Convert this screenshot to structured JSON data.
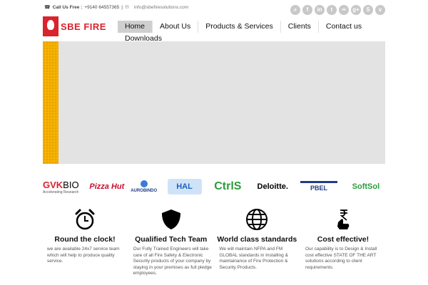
{
  "topbar": {
    "phone_label": "Call Us Free :",
    "phone_number": "+9140 64557365",
    "separator": "|",
    "email": "info@sbefiresolutions.com"
  },
  "social": [
    {
      "name": "search-icon",
      "glyph": "⌕"
    },
    {
      "name": "facebook-icon",
      "glyph": "f"
    },
    {
      "name": "linkedin-icon",
      "glyph": "in"
    },
    {
      "name": "twitter-icon",
      "glyph": "t"
    },
    {
      "name": "flickr-icon",
      "glyph": "••"
    },
    {
      "name": "googleplus-icon",
      "glyph": "g+"
    },
    {
      "name": "skype-icon",
      "glyph": "S"
    },
    {
      "name": "vimeo-icon",
      "glyph": "v"
    }
  ],
  "logo": {
    "text": "SBE FIRE"
  },
  "nav": {
    "items": [
      "Home",
      "About Us",
      "Products & Services",
      "Clients",
      "Contact us"
    ],
    "row2": [
      "Downloads"
    ]
  },
  "clients": {
    "gvk": {
      "name_a": "GVK",
      "name_b": "BIO",
      "tagline": "Accelerating Research"
    },
    "pizza": "Pizza Hut",
    "aurobindo": "AUROBINDO",
    "hal": "HAL",
    "ctrls": "CtrlS",
    "deloitte": "Deloitte.",
    "pbel": "PBEL",
    "softsol": "SoftSol"
  },
  "features": [
    {
      "icon": "alarm-clock-icon",
      "title": "Round the clock!",
      "text": "we are available 24x7 service team which will help to produce quality service."
    },
    {
      "icon": "shield-icon",
      "title": "Qualified Tech Team",
      "text": "Our Fully Trained Engineers will take care of all Fire Safety & Electronic Security products of your company by staying in your premises as full pledge employees."
    },
    {
      "icon": "globe-icon",
      "title": "World class standards",
      "text": "We will maintain NFPA and FM GLOBAL standards in Installing & maintainance of Fire Protection & Security Products."
    },
    {
      "icon": "rupee-hand-icon",
      "title": "Cost effective!",
      "text": "Our capability is to Design & Install cost effective STATE OF THE ART solutions according to client requirements."
    }
  ]
}
